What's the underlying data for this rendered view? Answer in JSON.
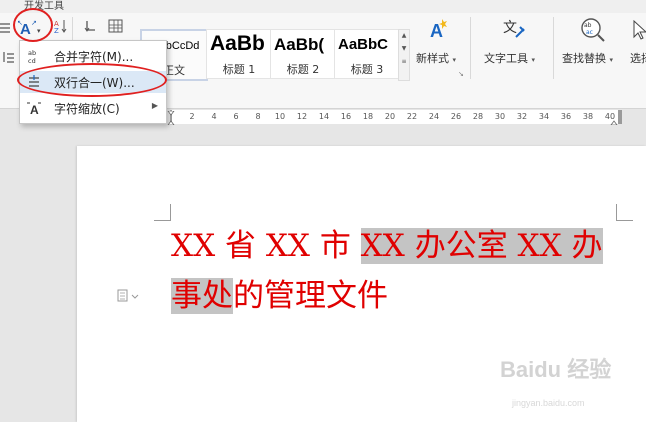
{
  "ribbon_tab_partial": "开发工具",
  "dropdown": {
    "items": [
      {
        "label": "合并字符(M)..."
      },
      {
        "label": "双行合一(W)..."
      },
      {
        "label": "字符缩放(C)"
      }
    ]
  },
  "styles": [
    {
      "preview": "AaBbCcDd",
      "label": "正文"
    },
    {
      "preview": "AaBb",
      "label": "标题 1"
    },
    {
      "preview": "AaBb(",
      "label": "标题 2"
    },
    {
      "preview": "AaBbC",
      "label": "标题 3"
    }
  ],
  "buttons": {
    "new_style": "新样式",
    "text_tools": "文字工具",
    "find_replace": "查找替换",
    "select": "选择"
  },
  "ruler_ticks": [
    "2",
    "4",
    "6",
    "8",
    "10",
    "12",
    "14",
    "16",
    "18",
    "20",
    "22",
    "24",
    "26",
    "28",
    "30",
    "32",
    "34",
    "36",
    "38",
    "40"
  ],
  "document": {
    "line1_a": "XX 省 XX 市 ",
    "line1_b": "XX 办公室 XX 办",
    "line2_a": "事处",
    "line2_b": "的管理文件"
  },
  "watermark": {
    "main": "Baidu 经验",
    "sub": "jingyan.baidu.com"
  },
  "colors": {
    "doc_text": "#e00000",
    "annotation": "#e02020",
    "menu_hover": "#dbe8f6"
  }
}
